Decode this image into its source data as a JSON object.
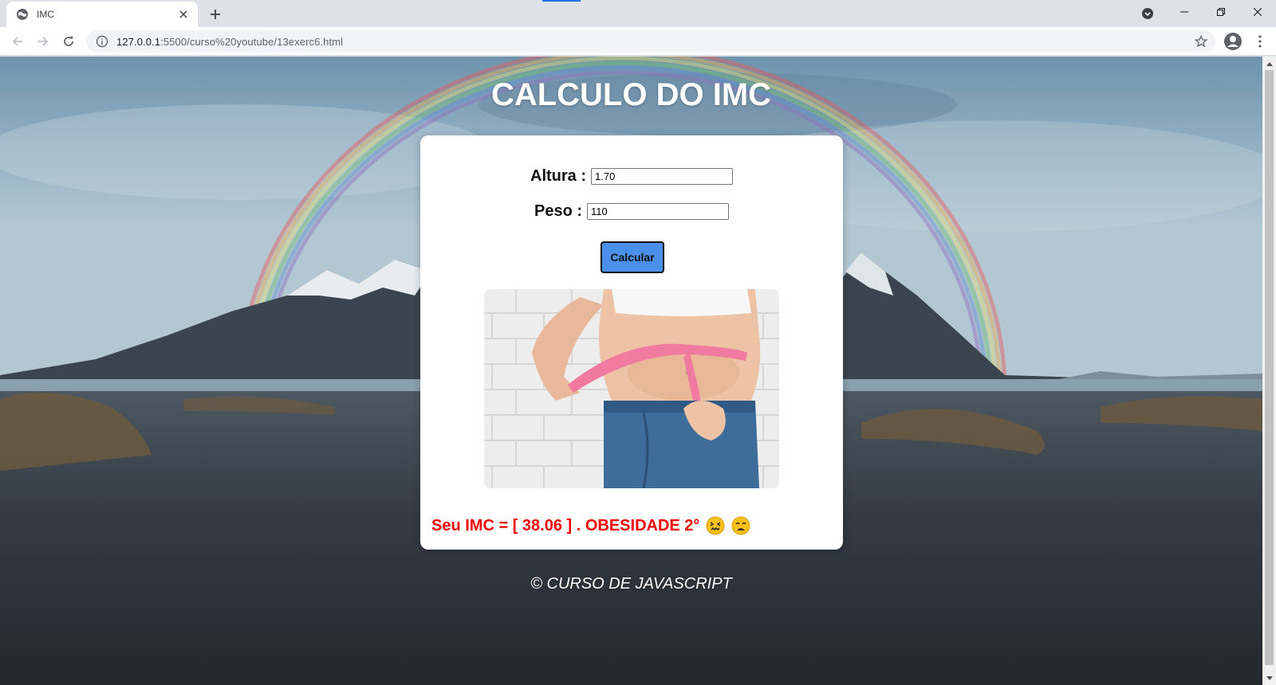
{
  "browser": {
    "tab_title": "IMC",
    "url_host": "127.0.0.1",
    "url_rest": ":5500/curso%20youtube/13exerc6.html",
    "icons": [
      "globe-icon",
      "close-icon",
      "plus-icon",
      "back-arrow-icon",
      "forward-arrow-icon",
      "reload-icon",
      "info-icon",
      "star-icon",
      "account-icon",
      "kebab-menu-icon"
    ]
  },
  "page": {
    "title": "CALCULO DO IMC",
    "form": {
      "altura_label": "Altura :",
      "altura_value": "1.70",
      "peso_label": "Peso :",
      "peso_value": "110",
      "button_label": "Calcular"
    },
    "result": {
      "text": "Seu IMC = [ 38.06 ] . OBESIDADE 2°",
      "emojis": [
        "confounded-face-icon",
        "weary-face-icon"
      ]
    },
    "footer": "© CURSO DE JAVASCRIPT"
  },
  "colors": {
    "result_text": "#ee0000",
    "button_bg": "#4a90ea",
    "accent": "#1a73e8"
  }
}
